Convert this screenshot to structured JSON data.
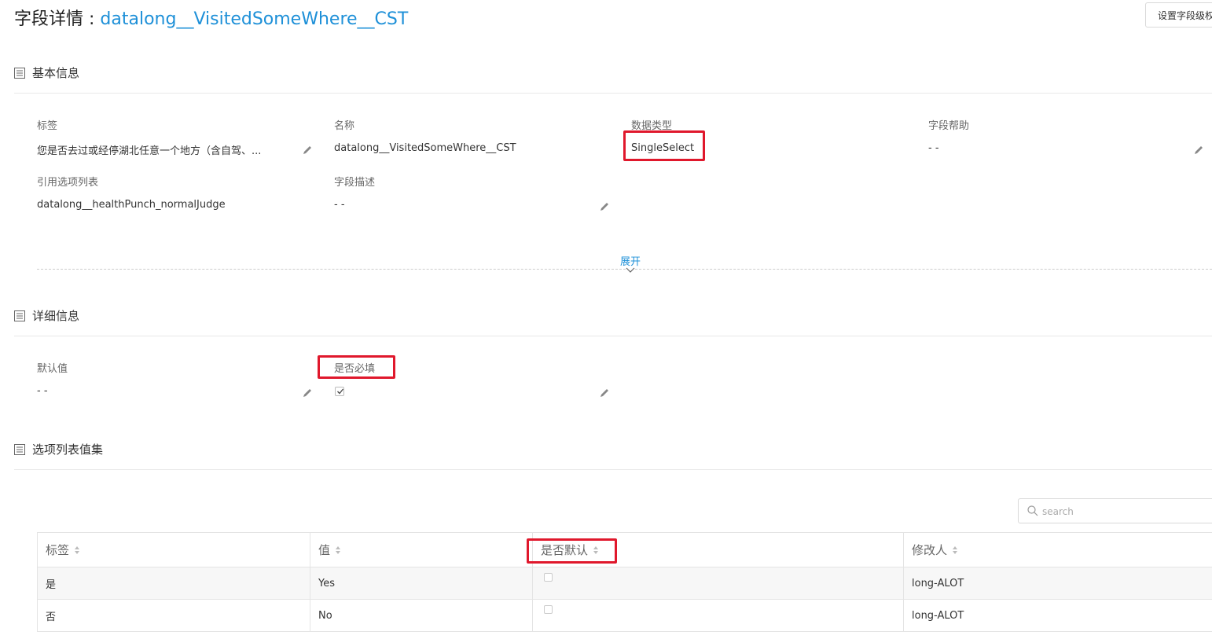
{
  "header": {
    "title_prefix": "字段详情 : ",
    "title_api": "datalong__VisitedSomeWhere__CST",
    "action_button": "设置字段级权限"
  },
  "sections": {
    "basic": "基本信息",
    "detail": "详细信息",
    "options": "选项列表值集"
  },
  "basic": {
    "label_label": "标签",
    "label_value": "您是否去过或经停湖北任意一个地方（含自驾、...",
    "name_label": "名称",
    "name_value": "datalong__VisitedSomeWhere__CST",
    "type_label": "数据类型",
    "type_value": "SingleSelect",
    "help_label": "字段帮助",
    "help_value": "- -",
    "picklist_label": "引用选项列表",
    "picklist_value": "datalong__healthPunch_normalJudge",
    "desc_label": "字段描述",
    "desc_value": "- -",
    "expand": "展开"
  },
  "detail": {
    "default_label": "默认值",
    "default_value": "- -",
    "required_label": "是否必填",
    "required_checked": true
  },
  "options": {
    "search_placeholder": "search",
    "columns": [
      "标签",
      "值",
      "是否默认",
      "修改人"
    ],
    "rows": [
      {
        "label": "是",
        "value": "Yes",
        "is_default": false,
        "modified_by": "long-ALOT"
      },
      {
        "label": "否",
        "value": "No",
        "is_default": false,
        "modified_by": "long-ALOT"
      }
    ]
  },
  "colors": {
    "accent": "#1e90d8",
    "highlight": "#e0182c"
  }
}
